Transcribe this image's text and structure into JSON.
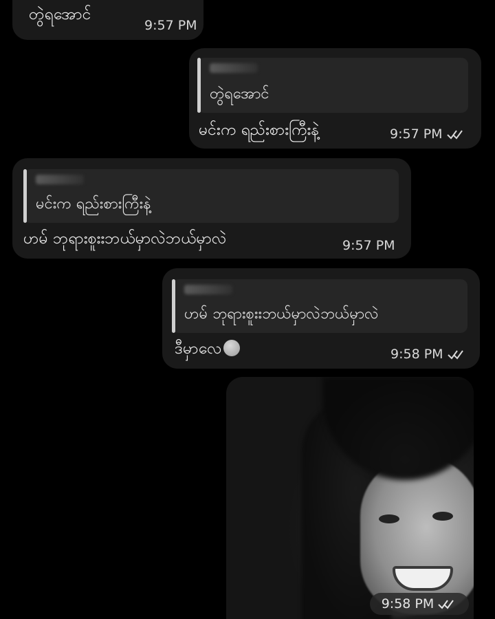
{
  "messages": [
    {
      "id": "m1",
      "side": "incoming",
      "text": "တွဲရအောင်",
      "time": "9:57 PM"
    },
    {
      "id": "m2",
      "side": "outgoing",
      "reply_to_text": "တွဲရအောင်",
      "text": "မင်းက ရည်းစားကြီးနဲ့",
      "time": "9:57 PM",
      "read": true
    },
    {
      "id": "m3",
      "side": "incoming",
      "reply_to_text": "မင်းက ရည်းစားကြီးနဲ့",
      "text": "ဟမ် ဘုရားစူးးဘယ်မှာလဲဘယ်မှာလဲ",
      "time": "9:57 PM"
    },
    {
      "id": "m4",
      "side": "outgoing",
      "reply_to_text": "ဟမ် ဘုရားစူးးဘယ်မှာလဲဘယ်မှာလဲ",
      "text": "ဒီမှာလေ",
      "emoji": "pensive-face-emoji",
      "time": "9:58 PM",
      "read": true
    },
    {
      "id": "m5",
      "side": "outgoing",
      "type": "photo",
      "time": "9:58 PM",
      "read": true
    }
  ],
  "icons": {
    "read_receipt": "double-check-icon"
  },
  "colors": {
    "background": "#000000",
    "bubble": "#1a1a1a",
    "quote": "#262626",
    "quote_bar": "#cfcfcf",
    "text": "#efefef"
  }
}
